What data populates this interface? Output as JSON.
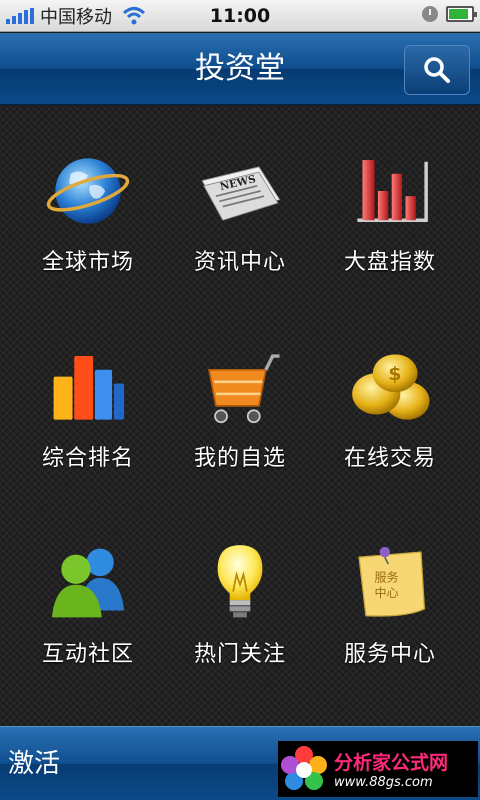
{
  "status_bar": {
    "carrier": "中国移动",
    "time": "11:00",
    "battery_level": 0.85
  },
  "header": {
    "title": "投资堂"
  },
  "tiles": [
    {
      "label": "全球市场",
      "icon": "globe-icon"
    },
    {
      "label": "资讯中心",
      "icon": "newspaper-icon"
    },
    {
      "label": "大盘指数",
      "icon": "bar-chart-icon"
    },
    {
      "label": "综合排名",
      "icon": "ranking-bars-icon"
    },
    {
      "label": "我的自选",
      "icon": "shopping-cart-icon"
    },
    {
      "label": "在线交易",
      "icon": "gold-coins-icon"
    },
    {
      "label": "互动社区",
      "icon": "community-users-icon"
    },
    {
      "label": "热门关注",
      "icon": "light-bulb-icon"
    },
    {
      "label": "服务中心",
      "icon": "sticky-note-icon"
    }
  ],
  "sticky_note_text": [
    "服务",
    "中心"
  ],
  "bottom_bar": {
    "activate_label": "激活",
    "watermark_title": "分析家公式网",
    "watermark_url": "www.88gs.com"
  },
  "colors": {
    "header_blue": "#0e4d8e",
    "background": "#1c1c1c",
    "label_white": "#ffffff",
    "watermark_pink": "#ff2a7a"
  }
}
